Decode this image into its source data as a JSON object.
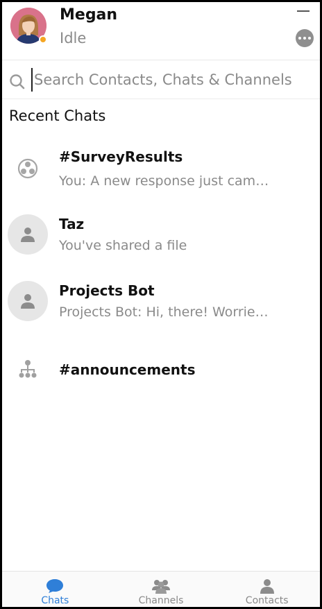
{
  "user": {
    "name": "Megan",
    "status": "Idle",
    "status_color": "#f5a623"
  },
  "search": {
    "placeholder": "Search Contacts, Chats & Channels",
    "value": ""
  },
  "section": {
    "title": "Recent Chats"
  },
  "chats": [
    {
      "name": "#SurveyResults",
      "preview": "You: A new response just came in",
      "icon": "channel-icon"
    },
    {
      "name": "Taz",
      "preview": "You've shared a file",
      "icon": "person-avatar-icon"
    },
    {
      "name": "Projects Bot",
      "preview": "Projects Bot: Hi, there! Worried about",
      "icon": "person-avatar-icon"
    },
    {
      "name": "#announcements",
      "preview": "",
      "icon": "org-channel-icon"
    }
  ],
  "nav": {
    "tabs": [
      {
        "label": "Chats",
        "icon": "chat-bubble-icon",
        "active": true
      },
      {
        "label": "Channels",
        "icon": "group-icon",
        "active": false
      },
      {
        "label": "Contacts",
        "icon": "person-icon",
        "active": false
      }
    ]
  },
  "colors": {
    "accent": "#2f7fd8",
    "muted_text": "#8a8a8a",
    "icon_gray": "#8c8c8c"
  }
}
